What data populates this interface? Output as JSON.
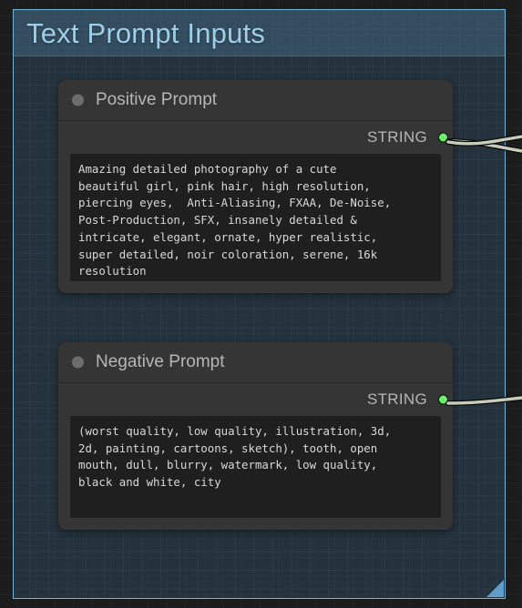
{
  "canvas": {
    "background_color": "#1c1c1c",
    "grid_color": "rgba(255,255,255,0.03)"
  },
  "group": {
    "title": "Text Prompt Inputs",
    "title_color": "#9fcfe8",
    "border_color": "#72b4d8",
    "fill_color": "rgba(49,85,112,0.40)",
    "resize_handle_color": "#5e9ec8"
  },
  "nodes": [
    {
      "id": "positive-prompt",
      "title": "Positive Prompt",
      "collapse_dot_color": "#6d6d6d",
      "header_color": "#353535",
      "outputs": [
        {
          "label": "STRING",
          "type": "STRING",
          "dot_color": "#6bf06b",
          "connected": true
        }
      ],
      "text": "Amazing detailed photography of a cute\nbeautiful girl, pink hair, high resolution,\npiercing eyes,  Anti-Aliasing, FXAA, De-Noise,\nPost-Production, SFX, insanely detailed &\nintricate, elegant, ornate, hyper realistic,\nsuper detailed, noir coloration, serene, 16k\nresolution"
    },
    {
      "id": "negative-prompt",
      "title": "Negative Prompt",
      "collapse_dot_color": "#6d6d6d",
      "header_color": "#353535",
      "outputs": [
        {
          "label": "STRING",
          "type": "STRING",
          "dot_color": "#6bf06b",
          "connected": true
        }
      ],
      "text": "(worst quality, low quality, illustration, 3d,\n2d, painting, cartoons, sketch), tooth, open\nmouth, dull, blurry, watermark, low quality,\nblack and white, city"
    }
  ],
  "wires": {
    "color": "#c8ccbc",
    "shadow_color": "#0c0c0c",
    "count": 3
  }
}
